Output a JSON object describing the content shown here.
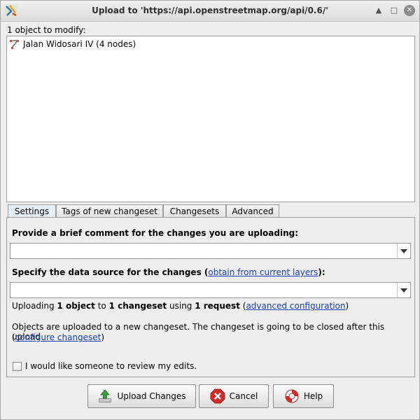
{
  "window": {
    "title": "Upload to 'https://api.openstreetmap.org/api/0.6/'",
    "icon": "josm-app-icon",
    "controls": [
      "minimize-icon",
      "maximize-icon",
      "close-icon"
    ]
  },
  "objects": {
    "label": "1 object to modify:",
    "items": [
      {
        "icon": "way-icon",
        "label": "Jalan Widosari IV (4 nodes)"
      }
    ]
  },
  "tabs": [
    {
      "label": "Settings",
      "active": true
    },
    {
      "label": "Tags of new changeset",
      "active": false
    },
    {
      "label": "Changesets",
      "active": false
    },
    {
      "label": "Advanced",
      "active": false
    }
  ],
  "settings": {
    "comment_label": "Provide a brief comment for the changes you are uploading:",
    "comment_value": "",
    "source_label_prefix": "Specify the data source for the changes (",
    "source_link": "obtain from current layers",
    "source_label_suffix": "):",
    "source_value": "",
    "uploading_parts": {
      "p1": "Uploading ",
      "b1": "1 object",
      "p2": " to ",
      "b2": "1 changeset",
      "p3": " using ",
      "b3": "1 request",
      "p4": " (",
      "link": "advanced configuration",
      "p5": ")"
    },
    "changeset_line1": "Objects are uploaded to a new changeset. The changeset is going to be closed after this upload",
    "changeset_prefix": "(",
    "changeset_link": "configure changeset",
    "changeset_suffix": ")",
    "review_checkbox_label": "I would like someone to review my edits.",
    "review_checked": false
  },
  "buttons": {
    "upload": "Upload Changes",
    "cancel": "Cancel",
    "help": "Help"
  },
  "colors": {
    "link": "#1a3fb8",
    "active_tab": "#e6eef8",
    "cancel_icon": "#d42a2a",
    "upload_icon": "#3b9a3b"
  }
}
